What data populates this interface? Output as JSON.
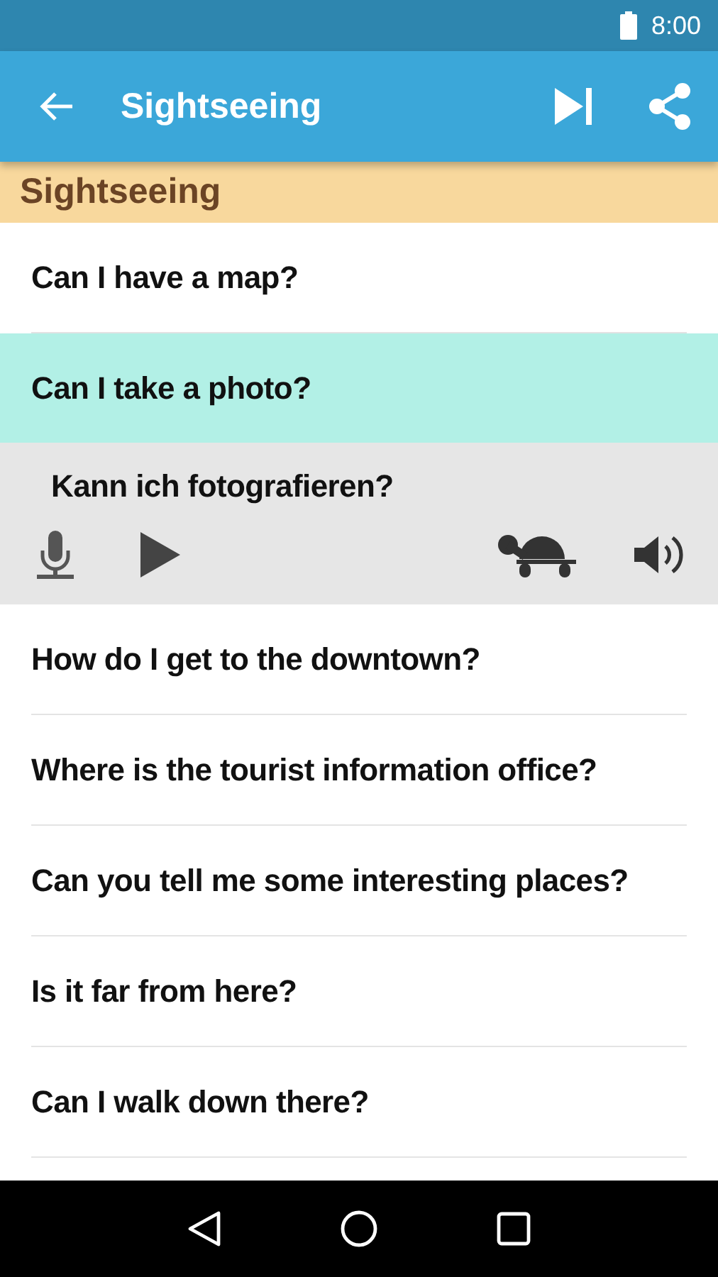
{
  "status_bar": {
    "time": "8:00"
  },
  "app_bar": {
    "title": "Sightseeing"
  },
  "section": {
    "title": "Sightseeing"
  },
  "phrases": [
    {
      "text": "Can I have a map?",
      "selected": false,
      "expanded": false
    },
    {
      "text": "Can I take a photo?",
      "selected": true,
      "expanded": true,
      "translation": "Kann ich fotografieren?"
    },
    {
      "text": "How do I get to the downtown?",
      "selected": false,
      "expanded": false
    },
    {
      "text": "Where is the tourist information office?",
      "selected": false,
      "expanded": false
    },
    {
      "text": "Can you tell me some interesting places?",
      "selected": false,
      "expanded": false
    },
    {
      "text": "Is it far from here?",
      "selected": false,
      "expanded": false
    },
    {
      "text": "Can I walk down there?",
      "selected": false,
      "expanded": false
    }
  ]
}
